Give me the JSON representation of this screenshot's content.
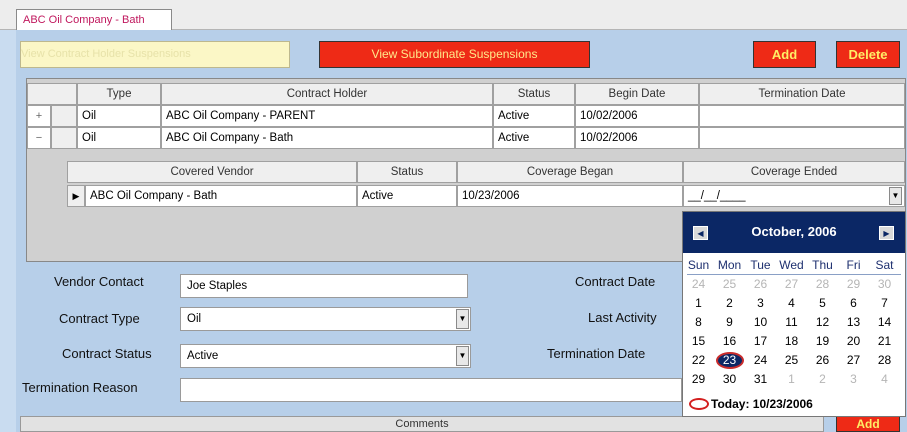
{
  "tab": {
    "label": "ABC Oil Company - Bath"
  },
  "toolbar": {
    "view_contract_holder_label": "View Contract Holder Suspensions",
    "view_subordinate_label": "View Subordinate Suspensions",
    "add_label": "Add",
    "delete_label": "Delete"
  },
  "contracts_grid": {
    "headers": [
      "Type",
      "Contract Holder",
      "Status",
      "Begin Date",
      "Termination Date"
    ],
    "rows": [
      {
        "expander": "+",
        "type": "Oil",
        "holder": "ABC Oil Company - PARENT",
        "status": "Active",
        "begin": "10/02/2006",
        "termination": ""
      },
      {
        "expander": "−",
        "type": "Oil",
        "holder": "ABC Oil Company - Bath",
        "status": "Active",
        "begin": "10/02/2006",
        "termination": ""
      }
    ]
  },
  "vendors_grid": {
    "headers": [
      "Covered Vendor",
      "Status",
      "Coverage Began",
      "Coverage Ended"
    ],
    "rows": [
      {
        "vendor": "ABC Oil Company - Bath",
        "status": "Active",
        "began": "10/23/2006",
        "ended": "__/__/____"
      }
    ]
  },
  "calendar": {
    "month_label": "October, 2006",
    "days_of_week": [
      "Sun",
      "Mon",
      "Tue",
      "Wed",
      "Thu",
      "Fri",
      "Sat"
    ],
    "weeks": [
      [
        "24",
        "25",
        "26",
        "27",
        "28",
        "29",
        "30"
      ],
      [
        "1",
        "2",
        "3",
        "4",
        "5",
        "6",
        "7"
      ],
      [
        "8",
        "9",
        "10",
        "11",
        "12",
        "13",
        "14"
      ],
      [
        "15",
        "16",
        "17",
        "18",
        "19",
        "20",
        "21"
      ],
      [
        "22",
        "23",
        "24",
        "25",
        "26",
        "27",
        "28"
      ],
      [
        "29",
        "30",
        "31",
        "1",
        "2",
        "3",
        "4"
      ]
    ],
    "selected_day": "23",
    "today_label": "Today: 10/23/2006"
  },
  "form": {
    "vendor_contact_label": "Vendor Contact",
    "vendor_contact_value": "Joe Staples",
    "contract_type_label": "Contract Type",
    "contract_type_value": "Oil",
    "contract_status_label": "Contract Status",
    "contract_status_value": "Active",
    "termination_reason_label": "Termination Reason",
    "termination_reason_value": "",
    "contract_date_label": "Contract Date",
    "last_activity_label": "Last Activity",
    "termination_date_label": "Termination Date"
  },
  "comments": {
    "label": "Comments"
  },
  "bottom": {
    "add_label": "Add"
  },
  "colors": {
    "accent_red": "#ee2a16",
    "calendar_header": "#0b2765",
    "form_background": "#b7cfe9"
  }
}
